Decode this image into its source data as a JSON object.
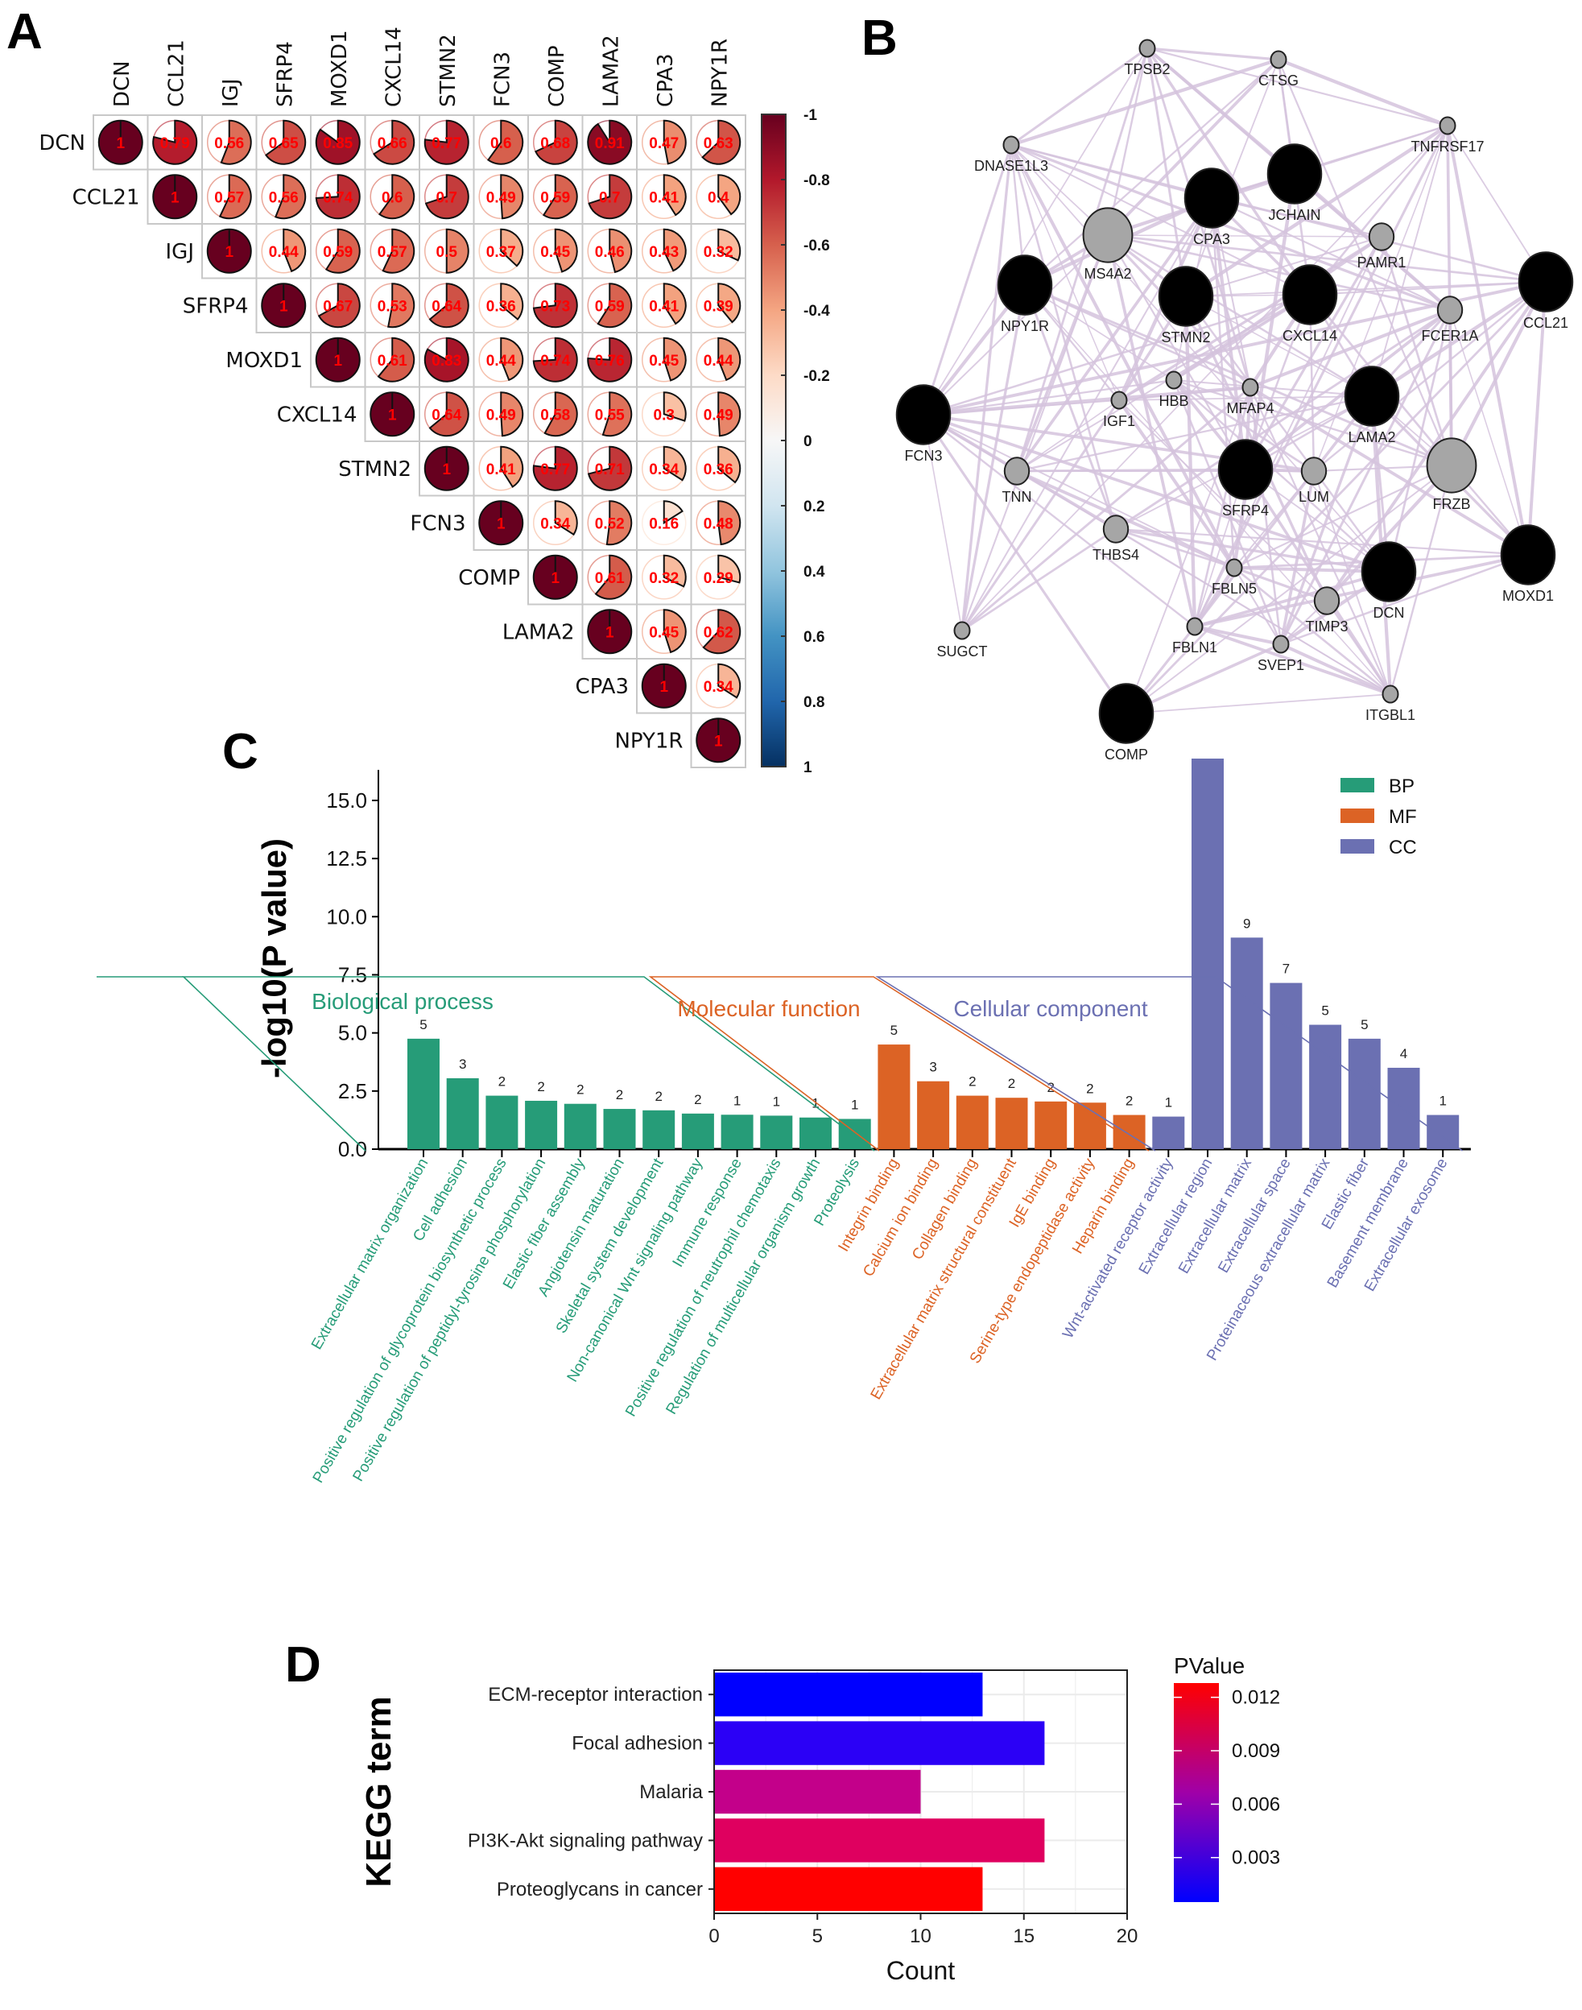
{
  "panels": {
    "a": "A",
    "b": "B",
    "c": "C",
    "d": "D"
  },
  "chart_data": [
    {
      "id": "A",
      "type": "heatmap",
      "subtype": "correlation-pie-matrix-upper",
      "genes": [
        "DCN",
        "CCL21",
        "IGJ",
        "SFRP4",
        "MOXD1",
        "CXCL14",
        "STMN2",
        "FCN3",
        "COMP",
        "LAMA2",
        "CPA3",
        "NPY1R"
      ],
      "matrix": [
        [
          1,
          0.79,
          0.56,
          0.65,
          0.85,
          0.66,
          0.77,
          0.6,
          0.68,
          0.91,
          0.47,
          0.63
        ],
        [
          null,
          1,
          0.57,
          0.56,
          0.74,
          0.6,
          0.7,
          0.49,
          0.59,
          0.7,
          0.41,
          0.4
        ],
        [
          null,
          null,
          1,
          0.44,
          0.59,
          0.57,
          0.5,
          0.37,
          0.45,
          0.46,
          0.43,
          0.32
        ],
        [
          null,
          null,
          null,
          1,
          0.67,
          0.53,
          0.64,
          0.36,
          0.73,
          0.59,
          0.41,
          0.39
        ],
        [
          null,
          null,
          null,
          null,
          1,
          0.61,
          0.83,
          0.44,
          0.74,
          0.76,
          0.45,
          0.44
        ],
        [
          null,
          null,
          null,
          null,
          null,
          1,
          0.64,
          0.49,
          0.58,
          0.55,
          0.3,
          0.49
        ],
        [
          null,
          null,
          null,
          null,
          null,
          null,
          1,
          0.41,
          0.77,
          0.71,
          0.34,
          0.36
        ],
        [
          null,
          null,
          null,
          null,
          null,
          null,
          null,
          1,
          0.34,
          0.52,
          0.16,
          0.48
        ],
        [
          null,
          null,
          null,
          null,
          null,
          null,
          null,
          null,
          1,
          0.61,
          0.32,
          0.29
        ],
        [
          null,
          null,
          null,
          null,
          null,
          null,
          null,
          null,
          null,
          1,
          0.45,
          0.62
        ],
        [
          null,
          null,
          null,
          null,
          null,
          null,
          null,
          null,
          null,
          null,
          1,
          0.34
        ],
        [
          null,
          null,
          null,
          null,
          null,
          null,
          null,
          null,
          null,
          null,
          null,
          1
        ]
      ],
      "colorbar": {
        "ticks": [
          "-1",
          "-0.8",
          "-0.6",
          "-0.4",
          "-0.2",
          "0",
          "0.2",
          "0.4",
          "0.6",
          "0.8",
          "1"
        ],
        "range": [
          -1,
          1
        ]
      },
      "value_label_color": "#ff0000"
    },
    {
      "id": "B",
      "type": "network",
      "nodes": [
        {
          "id": "TPSB2",
          "kind": "gray",
          "size": "small"
        },
        {
          "id": "CTSG",
          "kind": "gray",
          "size": "small"
        },
        {
          "id": "TNFRSF17",
          "kind": "gray",
          "size": "small"
        },
        {
          "id": "DNASE1L3",
          "kind": "gray",
          "size": "small"
        },
        {
          "id": "JCHAIN",
          "kind": "black",
          "size": "large"
        },
        {
          "id": "CPA3",
          "kind": "black",
          "size": "large"
        },
        {
          "id": "MS4A2",
          "kind": "gray",
          "size": "large"
        },
        {
          "id": "PAMR1",
          "kind": "gray",
          "size": "medium"
        },
        {
          "id": "NPY1R",
          "kind": "black",
          "size": "large"
        },
        {
          "id": "STMN2",
          "kind": "black",
          "size": "large"
        },
        {
          "id": "CXCL14",
          "kind": "black",
          "size": "large"
        },
        {
          "id": "FCER1A",
          "kind": "gray",
          "size": "medium"
        },
        {
          "id": "CCL21",
          "kind": "black",
          "size": "large"
        },
        {
          "id": "FCN3",
          "kind": "black",
          "size": "large"
        },
        {
          "id": "IGF1",
          "kind": "gray",
          "size": "small"
        },
        {
          "id": "HBB",
          "kind": "gray",
          "size": "small"
        },
        {
          "id": "MFAP4",
          "kind": "gray",
          "size": "small"
        },
        {
          "id": "LAMA2",
          "kind": "black",
          "size": "large"
        },
        {
          "id": "TNN",
          "kind": "gray",
          "size": "medium"
        },
        {
          "id": "SFRP4",
          "kind": "black",
          "size": "large"
        },
        {
          "id": "LUM",
          "kind": "gray",
          "size": "medium"
        },
        {
          "id": "FRZB",
          "kind": "gray",
          "size": "large"
        },
        {
          "id": "THBS4",
          "kind": "gray",
          "size": "medium"
        },
        {
          "id": "FBLN5",
          "kind": "gray",
          "size": "small"
        },
        {
          "id": "DCN",
          "kind": "black",
          "size": "large"
        },
        {
          "id": "MOXD1",
          "kind": "black",
          "size": "large"
        },
        {
          "id": "TIMP3",
          "kind": "gray",
          "size": "medium"
        },
        {
          "id": "SUGCT",
          "kind": "gray",
          "size": "small"
        },
        {
          "id": "FBLN1",
          "kind": "gray",
          "size": "small"
        },
        {
          "id": "SVEP1",
          "kind": "gray",
          "size": "small"
        },
        {
          "id": "ITGBL1",
          "kind": "gray",
          "size": "small"
        },
        {
          "id": "COMP",
          "kind": "black",
          "size": "large"
        }
      ],
      "edge_color": "#d5c3dd"
    },
    {
      "id": "C",
      "type": "bar",
      "ylabel": "-log10(P value)",
      "xlabel": "",
      "ylim": [
        0,
        16.8
      ],
      "yticks": [
        "0.0",
        "2.5",
        "5.0",
        "7.5",
        "10.0",
        "12.5",
        "15.0"
      ],
      "legend": [
        {
          "name": "BP",
          "color": "#269c78"
        },
        {
          "name": "MF",
          "color": "#dc6325"
        },
        {
          "name": "CC",
          "color": "#6b70b2"
        }
      ],
      "legend_position": "top-right",
      "groups": [
        {
          "name": "Biological process",
          "key": "BP",
          "color": "#269c78"
        },
        {
          "name": "Molecular function",
          "key": "MF",
          "color": "#dc6325"
        },
        {
          "name": "Cellular component",
          "key": "CC",
          "color": "#6b70b2"
        }
      ],
      "bars": [
        {
          "label": "Extracellular matrix organization",
          "group": "BP",
          "value": 4.75,
          "count": "5"
        },
        {
          "label": "Cell adhesion",
          "group": "BP",
          "value": 3.05,
          "count": "3"
        },
        {
          "label": "Positive regulation of glycoprotein biosynthetic process",
          "group": "BP",
          "value": 2.3,
          "count": "2"
        },
        {
          "label": "Positive regulation of peptidyl-tyrosine phosphorylation",
          "group": "BP",
          "value": 2.08,
          "count": "2"
        },
        {
          "label": "Elastic fiber assembly",
          "group": "BP",
          "value": 1.95,
          "count": "2"
        },
        {
          "label": "Angiotensin maturation",
          "group": "BP",
          "value": 1.73,
          "count": "2"
        },
        {
          "label": "Skeletal system development",
          "group": "BP",
          "value": 1.67,
          "count": "2"
        },
        {
          "label": "Non-canonical Wnt signaling pathway",
          "group": "BP",
          "value": 1.53,
          "count": "2"
        },
        {
          "label": "Immune response",
          "group": "BP",
          "value": 1.48,
          "count": "1"
        },
        {
          "label": "Positive regulation of neutrophil chemotaxis",
          "group": "BP",
          "value": 1.44,
          "count": "1"
        },
        {
          "label": "Regulation of multicellular organism growth",
          "group": "BP",
          "value": 1.36,
          "count": "1"
        },
        {
          "label": "Proteolysis",
          "group": "BP",
          "value": 1.3,
          "count": "1"
        },
        {
          "label": "Integrin binding",
          "group": "MF",
          "value": 4.5,
          "count": "5"
        },
        {
          "label": "Calcium ion binding",
          "group": "MF",
          "value": 2.92,
          "count": "3"
        },
        {
          "label": "Collagen binding",
          "group": "MF",
          "value": 2.3,
          "count": "2"
        },
        {
          "label": "Extracellular matrix structural constituent",
          "group": "MF",
          "value": 2.21,
          "count": "2"
        },
        {
          "label": "IgE binding",
          "group": "MF",
          "value": 2.05,
          "count": "2"
        },
        {
          "label": "Serine-type endopeptidase activity",
          "group": "MF",
          "value": 2.0,
          "count": "2"
        },
        {
          "label": "Heparin binding",
          "group": "MF",
          "value": 1.47,
          "count": "2"
        },
        {
          "label": "Wnt-activated receptor activity",
          "group": "CC",
          "value": 1.4,
          "count": "1"
        },
        {
          "label": "Extracellular region",
          "group": "CC",
          "value": 16.8,
          "count": ""
        },
        {
          "label": "Extracellular matrix",
          "group": "CC",
          "value": 9.1,
          "count": "9"
        },
        {
          "label": "Extracellular space",
          "group": "CC",
          "value": 7.15,
          "count": "7"
        },
        {
          "label": "Proteinaceous extracellular matrix",
          "group": "CC",
          "value": 5.35,
          "count": "5"
        },
        {
          "label": "Elastic fiber",
          "group": "CC",
          "value": 4.75,
          "count": "5"
        },
        {
          "label": "Basement membrane",
          "group": "CC",
          "value": 3.5,
          "count": "4"
        },
        {
          "label": "Extracellular exosome",
          "group": "CC",
          "value": 1.47,
          "count": "1"
        }
      ]
    },
    {
      "id": "D",
      "type": "bar",
      "orientation": "horizontal",
      "ylabel": "KEGG term",
      "xlabel": "Count",
      "xlim": [
        0,
        20
      ],
      "xticks": [
        "0",
        "5",
        "10",
        "15",
        "20"
      ],
      "grid": true,
      "categories": [
        "ECM-receptor interaction",
        "Focal adhesion",
        "Malaria",
        "PI3K-Akt signaling pathway",
        "Proteoglycans in cancer"
      ],
      "values": [
        13,
        16,
        10,
        16,
        13
      ],
      "pvalues": [
        0.0005,
        0.0018,
        0.0068,
        0.0098,
        0.0128
      ],
      "colors": [
        "#0000ff",
        "#2b00f6",
        "#c3008a",
        "#df005f",
        "#ff0000"
      ],
      "colorbar": {
        "title": "PValue",
        "ticks": [
          "0.003",
          "0.006",
          "0.009",
          "0.012"
        ],
        "range": [
          0.0005,
          0.0128
        ],
        "low_color": "#0000ff",
        "high_color": "#ff0000"
      }
    }
  ]
}
